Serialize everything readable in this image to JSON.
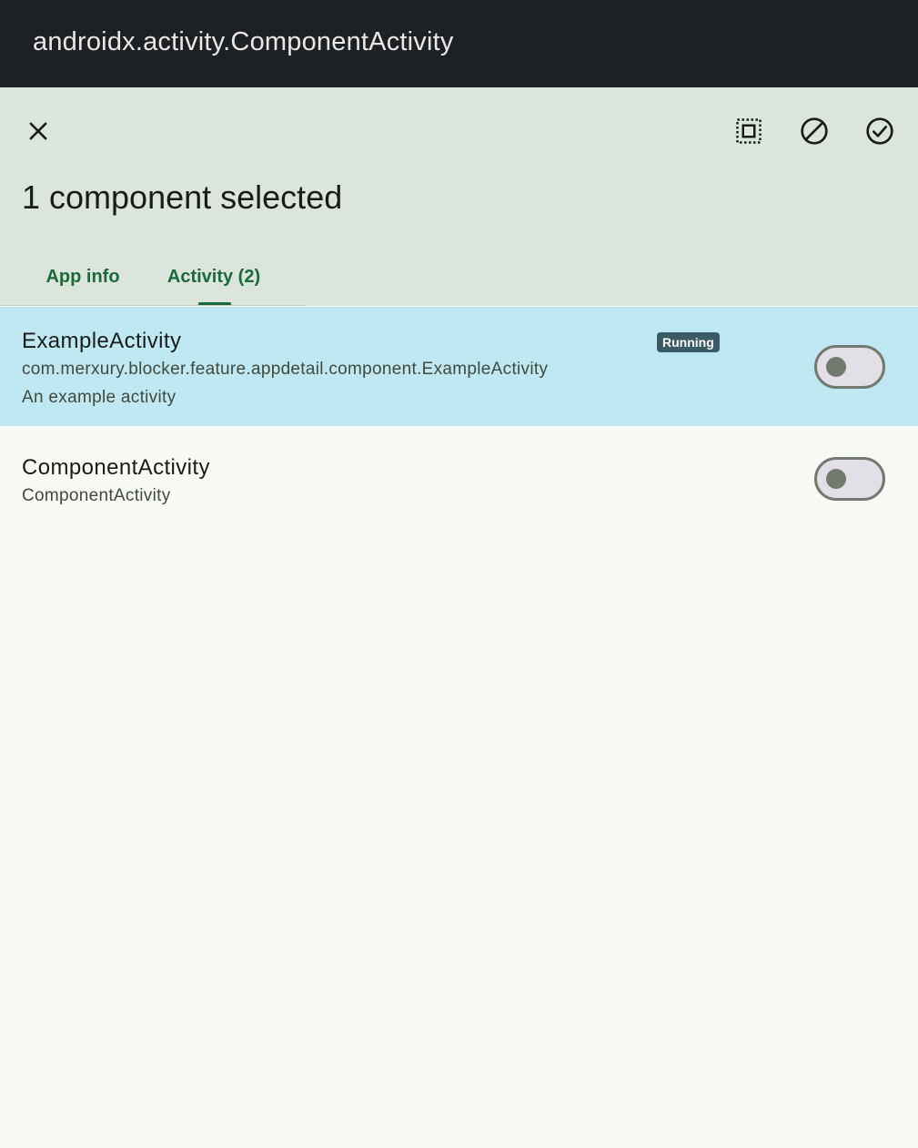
{
  "window": {
    "title": "androidx.activity.ComponentActivity"
  },
  "appbar": {
    "selection_title": "1 component selected",
    "icons": [
      "close-icon",
      "select-all-icon",
      "block-icon",
      "check-circle-icon"
    ]
  },
  "tabs": [
    {
      "label": "App info",
      "selected": false
    },
    {
      "label": "Activity (2)",
      "selected": true
    }
  ],
  "components": [
    {
      "name": "ExampleActivity",
      "package": "com.merxury.blocker.feature.appdetail.component.ExampleActivity",
      "description": "An example activity",
      "badge": "Running",
      "selected": true,
      "enabled": false
    },
    {
      "name": "ComponentActivity",
      "package": "ComponentActivity",
      "selected": false,
      "enabled": false
    }
  ],
  "colors": {
    "titlebar": "#1d2024",
    "appbar": "#dce5dc",
    "accent": "#1a6b3a",
    "selected_row": "#bfe8f2",
    "badge": "#3a5a66"
  }
}
